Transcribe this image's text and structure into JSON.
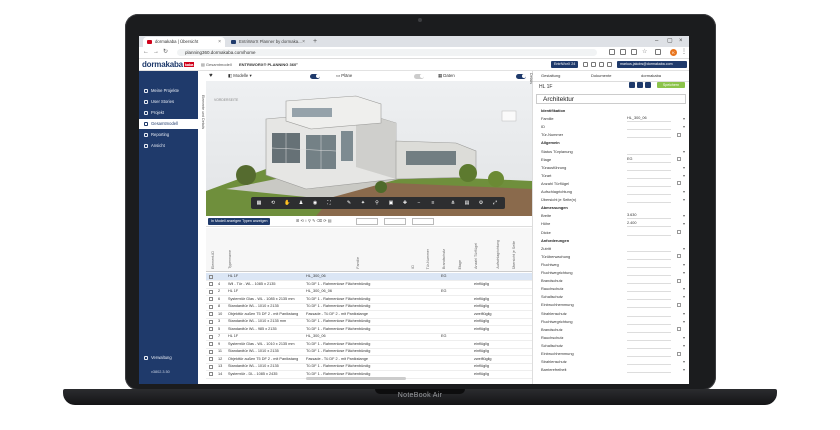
{
  "device": {
    "label": "NoteBook Air"
  },
  "browser": {
    "tabs": [
      {
        "label": "dormakaba | Übersicht"
      },
      {
        "label": "EntriWorX Planner by dormaka..."
      }
    ],
    "url": "planning360.dormakaba.com/home"
  },
  "header": {
    "logo": "dormakaba",
    "logo_badge": "kaba",
    "breadcrumb": "Gesamtmodell",
    "project_title": "ENTRIWORX® PLANNING 360°",
    "user_btn": "EntriWorX 24",
    "user_email": "markus.jakobs@dormakaba.com"
  },
  "sidebar": {
    "items": [
      {
        "label": "Meine Projekte"
      },
      {
        "label": "User Stories"
      },
      {
        "label": "Projekt"
      },
      {
        "label": "Gesamtmodell"
      },
      {
        "label": "Reporting"
      },
      {
        "label": "Ansicht"
      }
    ],
    "footer_items": [
      {
        "label": "Verwaltung"
      },
      {
        "label": "v3802.3.50"
      }
    ],
    "vertical_tab": "Elemente und Details"
  },
  "viewer": {
    "model_label": "Modelle",
    "plans_label": "Pläne",
    "data_label": "Daten",
    "view_cube": "VORDERSEITE"
  },
  "grid": {
    "filter_button": "In Modell anzeigen   Typen anzeigen",
    "columns": [
      "Element-ID",
      "Typenname",
      "",
      "",
      "Familie",
      "ID",
      "Tür-Nummer",
      "Brandschutz",
      "Etage",
      "Anzahl Türflügel",
      "Aufschlagrichtung",
      "Übersicht je Seite"
    ],
    "rows": [
      {
        "id": "",
        "type": "HL 1F",
        "family": "HL_300_06",
        "floor": "EG",
        "dir": ""
      },
      {
        "id": "4",
        "type": "Wil - Tür - WL - 1085 x 2135",
        "family": "Tü DF 1 - Rahmenlose Flächenbündig",
        "floor": "",
        "dir": "einflüglig"
      },
      {
        "id": "2",
        "type": "HL 1F",
        "family": "HL_300_06_06",
        "floor": "EG",
        "dir": ""
      },
      {
        "id": "6",
        "type": "Systemtür Glas - WL - 1085 x 2135 mm",
        "family": "Tü DF 1 - Rahmenlose Flächenbündig",
        "floor": "",
        "dir": "einflüglig"
      },
      {
        "id": "8",
        "type": "Standardtür WL - 1010 x 2135",
        "family": "Tü DF 1 - Rahmenlose Flächenbündig",
        "floor": "",
        "dir": "einflüglig"
      },
      {
        "id": "10",
        "type": "Objekttür außen T5 DF 2 - mit Panikstange",
        "family": "Fassade - Tü DF 2 - mit Panikstange",
        "floor": "",
        "dir": "zweiflüglig"
      },
      {
        "id": "3",
        "type": "Standardtür WL - 1010 x 2135 mm",
        "family": "Tü DF 1 - Rahmenlose Flächenbündig",
        "floor": "",
        "dir": "einflüglig"
      },
      {
        "id": "5",
        "type": "Standardtür WL - 985 x 2135",
        "family": "Tü DF 1 - Rahmenlose Flächenbündig",
        "floor": "",
        "dir": "einflüglig"
      },
      {
        "id": "7",
        "type": "HL 1F",
        "family": "HL_300_06",
        "floor": "EG",
        "dir": ""
      },
      {
        "id": "9",
        "type": "Systemtür Glas - WL - 1010 x 2135 mm",
        "family": "Tü DF 1 - Rahmenlose Flächenbündig",
        "floor": "",
        "dir": "einflüglig"
      },
      {
        "id": "11",
        "type": "Standardtür WL - 1010 x 2135",
        "family": "Tü DF 1 - Rahmenlose Flächenbündig",
        "floor": "",
        "dir": "einflüglig"
      },
      {
        "id": "12",
        "type": "Objekttür außen T5 DF 2 - mit Panikstange",
        "family": "Fassade - Tü DF 2 - mit Panikstange",
        "floor": "",
        "dir": "zweiflüglig"
      },
      {
        "id": "13",
        "type": "Standardtür WL - 1010 x 2135",
        "family": "Tü DF 1 - Rahmenlose Flächenbündig",
        "floor": "",
        "dir": "einflüglig"
      },
      {
        "id": "14",
        "type": "Systemtür - DL - 1085 x 2435",
        "family": "Tü DF 1 - Rahmenlose Flächenbündig",
        "floor": "",
        "dir": "einflüglig"
      }
    ]
  },
  "panel": {
    "tabs": [
      "Gestaltung",
      "Dokumente",
      "dormakaba"
    ],
    "element_title": "HL 1F",
    "apply_btn": "Speichern",
    "section_title": "Architektur",
    "rows": [
      {
        "k": "Identifikation",
        "v": "",
        "hdr": true
      },
      {
        "k": "Familie",
        "v": "HL_300_06",
        "hdr": false
      },
      {
        "k": "ID",
        "v": "",
        "hdr": false
      },
      {
        "k": "Tür-Nummer",
        "v": "",
        "hdr": false
      },
      {
        "k": "Allgemein",
        "v": "",
        "hdr": true
      },
      {
        "k": "Status Türplanung",
        "v": "",
        "hdr": false
      },
      {
        "k": "Etage",
        "v": "EG",
        "hdr": false
      },
      {
        "k": "Türausführung",
        "v": "",
        "hdr": false
      },
      {
        "k": "Türart",
        "v": "",
        "hdr": false
      },
      {
        "k": "Anzahl Türflügel",
        "v": "",
        "hdr": false
      },
      {
        "k": "Aufschlagrichtung",
        "v": "",
        "hdr": false
      },
      {
        "k": "Übersicht je Seite(n)",
        "v": "",
        "hdr": false
      },
      {
        "k": "Abmessungen",
        "v": "",
        "hdr": true
      },
      {
        "k": "Breite",
        "v": "3.630",
        "hdr": false
      },
      {
        "k": "Höhe",
        "v": "2.400",
        "hdr": false
      },
      {
        "k": "Dicke",
        "v": "",
        "hdr": false
      },
      {
        "k": "Anforderungen",
        "v": "",
        "hdr": true
      },
      {
        "k": "Zutritt",
        "v": "",
        "hdr": false
      },
      {
        "k": "Türüberwachung",
        "v": "",
        "hdr": false
      },
      {
        "k": "Fluchtweg",
        "v": "",
        "hdr": false
      },
      {
        "k": "Fluchtwegrichtung",
        "v": "",
        "hdr": false
      },
      {
        "k": "Brandschutz",
        "v": "",
        "hdr": false
      },
      {
        "k": "Rauchschutz",
        "v": "",
        "hdr": false
      },
      {
        "k": "Schallschutz",
        "v": "",
        "hdr": false
      },
      {
        "k": "Einbruchhemmung",
        "v": "",
        "hdr": false
      },
      {
        "k": "Strahlenschutz",
        "v": "",
        "hdr": false
      },
      {
        "k": "Fluchtwegrichtung",
        "v": "",
        "hdr": false
      },
      {
        "k": "Brandschutz",
        "v": "",
        "hdr": false
      },
      {
        "k": "Rauchschutz",
        "v": "",
        "hdr": false
      },
      {
        "k": "Schallschutz",
        "v": "",
        "hdr": false
      },
      {
        "k": "Einbruchhemmung",
        "v": "",
        "hdr": false
      },
      {
        "k": "Strahlenschutz",
        "v": "",
        "hdr": false
      },
      {
        "k": "Barrierefreiheit",
        "v": "",
        "hdr": false
      }
    ]
  },
  "colors": {
    "brand_navy": "#1f3a6b",
    "brand_red": "#d0021b",
    "accent_green": "#8bc34a"
  }
}
